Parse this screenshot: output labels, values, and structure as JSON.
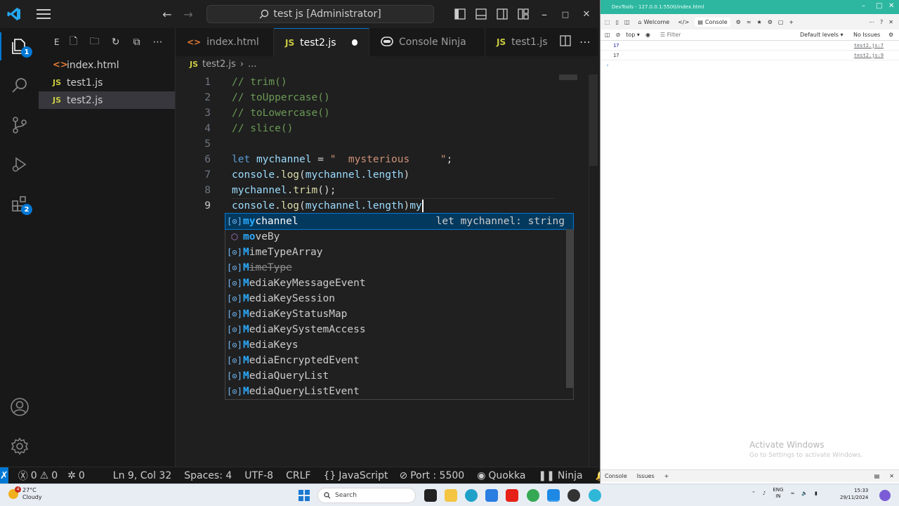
{
  "titlebar": {
    "command_center": "test js [Administrator]"
  },
  "activitybar": {
    "explorer_badge": "1",
    "extensions_badge": "2"
  },
  "sidebar": {
    "header": "E",
    "files": [
      {
        "name": "index.html",
        "type": "html"
      },
      {
        "name": "test1.js",
        "type": "js"
      },
      {
        "name": "test2.js",
        "type": "js"
      }
    ]
  },
  "tabs": [
    {
      "label": "index.html",
      "icon": "<>"
    },
    {
      "label": "test2.js",
      "icon": "JS"
    },
    {
      "label": "Console Ninja",
      "icon": "ninja"
    },
    {
      "label": "test1.js",
      "icon": "JS"
    }
  ],
  "breadcrumb": {
    "file": "test2.js",
    "rest": "..."
  },
  "code": {
    "line_numbers": [
      "1",
      "2",
      "3",
      "4",
      "5",
      "6",
      "7",
      "8",
      "9"
    ],
    "l1": "// trim()",
    "l2": "// toUppercase()",
    "l3": "// toLowercase()",
    "l4": "// slice()",
    "l6_kw": "let",
    "l6_var": "mychannel",
    "l6_eq": " = ",
    "l6_str": "\"  mysterious     \"",
    "l6_semi": ";",
    "l7_obj": "console",
    "l7_dot": ".",
    "l7_fn": "log",
    "l7_open": "(",
    "l7_var": "mychannel",
    "l7_prop": ".length",
    "l7_close": ")",
    "l8_var": "mychannel",
    "l8_dot": ".",
    "l8_fn": "trim",
    "l8_rest": "();",
    "l9_obj": "console",
    "l9_dot": ".",
    "l9_fn": "log",
    "l9_open": "(",
    "l9_var": "mychannel",
    "l9_prop": ".length",
    "l9_close": ")",
    "l9_typed": "my"
  },
  "suggest": {
    "items": [
      {
        "match": "my",
        "rest": "channel",
        "kind": "variable",
        "detail": "let mychannel: string"
      },
      {
        "match": "mo",
        "rest": "veBy",
        "kind": "method"
      },
      {
        "match": "M",
        "rest": "imeTypeArray",
        "kind": "variable"
      },
      {
        "match": "M",
        "rest": "imeType",
        "kind": "variable"
      },
      {
        "match": "M",
        "rest": "ediaKeyMessageEvent",
        "kind": "variable"
      },
      {
        "match": "M",
        "rest": "ediaKeySession",
        "kind": "variable"
      },
      {
        "match": "M",
        "rest": "ediaKeyStatusMap",
        "kind": "variable"
      },
      {
        "match": "M",
        "rest": "ediaKeySystemAccess",
        "kind": "variable"
      },
      {
        "match": "M",
        "rest": "ediaKeys",
        "kind": "variable"
      },
      {
        "match": "M",
        "rest": "ediaEncryptedEvent",
        "kind": "variable"
      },
      {
        "match": "M",
        "rest": "ediaQueryList",
        "kind": "variable"
      },
      {
        "match": "M",
        "rest": "ediaQueryListEvent",
        "kind": "variable"
      }
    ]
  },
  "statusbar": {
    "errors": "0",
    "warnings": "0",
    "ports": "0",
    "position": "Ln 9, Col 32",
    "spaces": "Spaces: 4",
    "encoding": "UTF-8",
    "eol": "CRLF",
    "language": "JavaScript",
    "port": "Port : 5500",
    "quokka": "Quokka",
    "ninja": "Ninja"
  },
  "devtools": {
    "title": "DevTools - 127.0.0.1:5500/index.html",
    "tab_welcome": "Welcome",
    "tab_console": "Console",
    "context": "top",
    "filter": "Filter",
    "levels": "Default levels",
    "issues": "No Issues",
    "logs": [
      {
        "value": "17",
        "source": "test2.js:7"
      },
      {
        "value": "17",
        "source": "test2.js:9"
      }
    ],
    "activate_title": "Activate Windows",
    "activate_sub": "Go to Settings to activate Windows.",
    "drawer_console": "Console",
    "drawer_issues": "Issues"
  },
  "taskbar": {
    "weather_temp": "27°C",
    "weather_desc": "Cloudy",
    "weather_badge": "4",
    "search": "Search",
    "lang": "ENG",
    "region": "IN",
    "time": "15:33",
    "date": "29/11/2024"
  },
  "colors": {
    "accent": "#0078d4",
    "devtools_title": "#2db7a0"
  }
}
